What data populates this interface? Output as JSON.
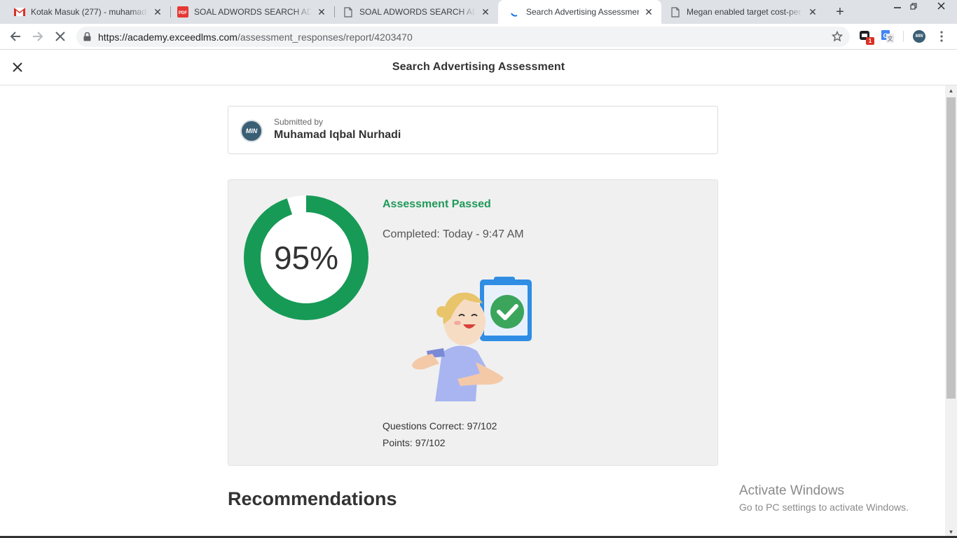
{
  "browser": {
    "tabs": [
      {
        "title": "Kotak Masuk (277) - muhamadiq",
        "icon": "gmail-icon",
        "active": false
      },
      {
        "title": "SOAL ADWORDS SEARCH ADVA",
        "icon": "pdf-icon",
        "active": false
      },
      {
        "title": "SOAL ADWORDS SEARCH ADVA",
        "icon": "document-icon",
        "active": false
      },
      {
        "title": "Search Advertising Assessment",
        "icon": "loading-icon",
        "active": true
      },
      {
        "title": "Megan enabled target cost-per",
        "icon": "document-icon",
        "active": false
      }
    ],
    "url_host": "https://academy.exceedlms.com",
    "url_path": "/assessment_responses/report/4203470",
    "extension_badge": "1",
    "profile_initials": "MIN"
  },
  "page": {
    "title": "Search Advertising Assessment"
  },
  "submission": {
    "label": "Submitted by",
    "name": "Muhamad Iqbal Nurhadi",
    "avatar_initials": "MIN"
  },
  "result": {
    "score_percent": 95,
    "score_label": "95%",
    "status": "Assessment Passed",
    "completed": "Completed: Today - 9:47 AM",
    "questions_correct": "Questions Correct: 97/102",
    "points": "Points: 97/102",
    "pass_color": "#179a56"
  },
  "recommendations": {
    "heading": "Recommendations"
  },
  "watermark": {
    "line1": "Activate Windows",
    "line2": "Go to PC settings to activate Windows."
  }
}
